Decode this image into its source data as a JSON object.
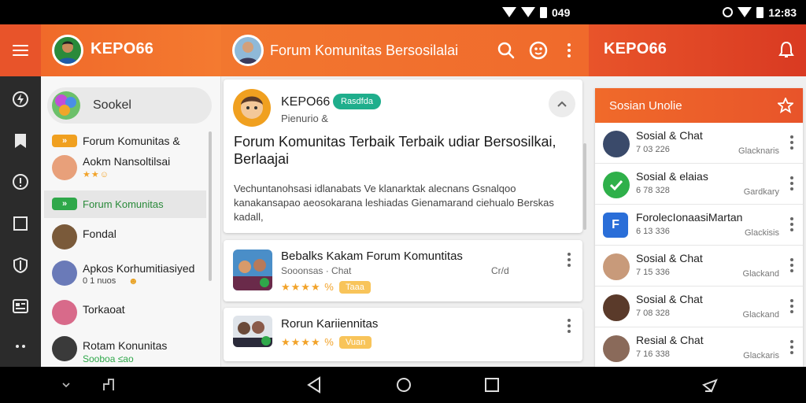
{
  "status_bar": {
    "left_text": "049",
    "right_time": "12:83"
  },
  "rail": {
    "menu_icon": "hamburger-icon",
    "items": [
      "flash-icon",
      "bookmark-icon",
      "info-icon",
      "square-icon",
      "shield-icon",
      "gallery-icon",
      "more-icon"
    ]
  },
  "header": {
    "app_title": "KEPO66",
    "forum_title": "Forum Komunitas Bersosilalai",
    "right_title": "KEPO66",
    "accent": "#f06a2a"
  },
  "sidebar": {
    "search_label": "Sookel",
    "items": [
      {
        "chip": "»",
        "label": "Forum Komunitas &"
      },
      {
        "label": "Aokm Nansoltilsai",
        "rating": "★★☺"
      },
      {
        "chip": "»",
        "label": "Forum Komunitas",
        "selected": true
      },
      {
        "label": "Fondal"
      },
      {
        "label": "Apkos Korhumitiasiyed",
        "sub": "0 1 nuos",
        "emoji": "☻"
      },
      {
        "label": "Torkaoat"
      },
      {
        "label": "Rotam Konunitas",
        "sub": "Sooboa ≤ao"
      }
    ]
  },
  "post": {
    "author": "KEPO66",
    "badge": "Rasdfda",
    "meta": "Pienurio &",
    "headline": "Forum Komunitas Terbaik Terbaik udiar Bersosilkai, Berlaajai",
    "body": "Vechuntanohsasi idlanabats Ve klanarktak alecnans Gsnalqoo kanakansapao aeosokarana leshiadas Gienamarand ciehualo Berskas kadall,"
  },
  "list_cards": [
    {
      "title": "Bebalks Kakam Forum Komuntitas",
      "sub": "Sooonsas · Chat",
      "extra": "Cr/d",
      "rating": "★★★★ %",
      "chip": "Taaa"
    },
    {
      "title": "Rorun Kariiennitas",
      "rating": "★★★★ %",
      "chip": "Vuan"
    }
  ],
  "right_panel": {
    "title": "Sosian Unolie",
    "rows": [
      {
        "name": "Sosial & Chat",
        "count": "7 03 226",
        "status": "Glacknaris"
      },
      {
        "name": "Sosial & elaias",
        "count": "6 78 328",
        "status": "Gardkary"
      },
      {
        "name": "ForolecIonaasiMartan",
        "count": "6 13 336",
        "status": "Glackisis"
      },
      {
        "name": "Sosial & Chat",
        "count": "7 15 336",
        "status": "Glackand"
      },
      {
        "name": "Sosial & Chat",
        "count": "7 08 328",
        "status": "Glackand"
      },
      {
        "name": "Resial & Chat",
        "count": "7 16 338",
        "status": "Glackaris"
      }
    ]
  },
  "navbar": {
    "items": [
      "chevron-down-icon",
      "rotate-icon",
      "back-icon",
      "home-icon",
      "recents-icon",
      "keyboard-icon"
    ]
  }
}
